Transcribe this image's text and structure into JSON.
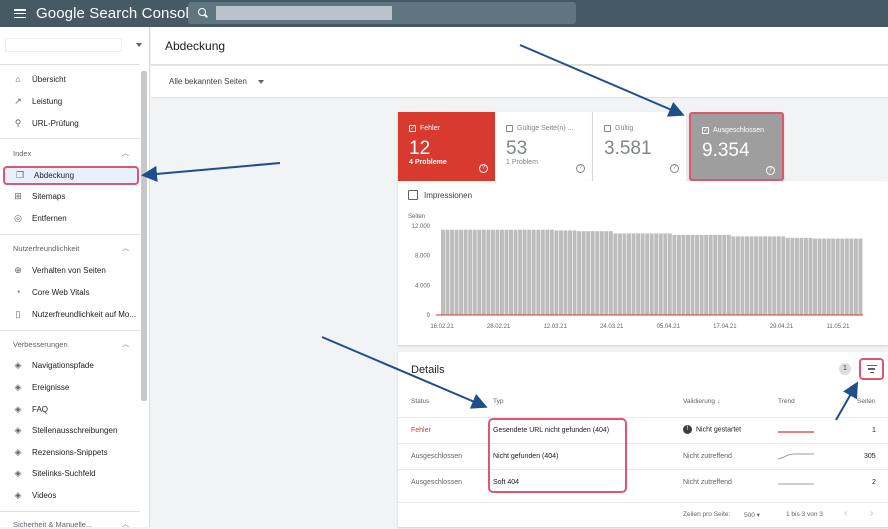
{
  "app": {
    "title": "Google Search Console",
    "search_value": ""
  },
  "header": {
    "title": "Abdeckung"
  },
  "filter": {
    "label": "Alle bekannten Seiten"
  },
  "sidebar": {
    "top_items": [
      {
        "label": "Übersicht",
        "icon": "home-icon"
      },
      {
        "label": "Leistung",
        "icon": "trending-up-icon"
      },
      {
        "label": "URL-Prüfung",
        "icon": "search-icon"
      }
    ],
    "index_section": "Index",
    "index_items": [
      {
        "label": "Abdeckung",
        "icon": "copy-icon"
      },
      {
        "label": "Sitemaps",
        "icon": "sitemap-icon"
      },
      {
        "label": "Entfernen",
        "icon": "eye-off-icon"
      }
    ],
    "usability_section": "Nutzerfreundlichkeit",
    "usability_items": [
      {
        "label": "Verhalten von Seiten",
        "icon": "circle-plus-icon"
      },
      {
        "label": "Core Web Vitals",
        "icon": "speed-icon"
      },
      {
        "label": "Nutzerfreundlichkeit auf Mo...",
        "icon": "phone-icon"
      }
    ],
    "enhancements_section": "Verbesserungen",
    "enhancements_items": [
      {
        "label": "Navigationspfade",
        "icon": "layers-icon"
      },
      {
        "label": "Ereignisse",
        "icon": "layers-icon"
      },
      {
        "label": "FAQ",
        "icon": "layers-icon"
      },
      {
        "label": "Stellenausschreibungen",
        "icon": "layers-icon"
      },
      {
        "label": "Rezensions-Snippets",
        "icon": "layers-icon"
      },
      {
        "label": "Sitelinks-Suchfeld",
        "icon": "layers-icon"
      },
      {
        "label": "Videos",
        "icon": "layers-icon"
      }
    ],
    "security_section": "Sicherheit & Manuelle..."
  },
  "tiles": {
    "error": {
      "label": "Fehler",
      "value": "12",
      "sub": "4 Probleme"
    },
    "warning": {
      "label": "Gültige Seite(n) ...",
      "value": "53",
      "sub": "1 Problem"
    },
    "valid": {
      "label": "Gültig",
      "value": "3.581",
      "sub": ""
    },
    "excluded": {
      "label": "Ausgeschlossen",
      "value": "9.354",
      "sub": ""
    }
  },
  "chart": {
    "impressions_label": "Impressionen",
    "ylabel": "Seiten"
  },
  "chart_data": {
    "type": "bar",
    "ylabel": "Seiten",
    "ylim": [
      0,
      12000
    ],
    "yticks": [
      "12.000",
      "8.000",
      "4.000",
      "0"
    ],
    "xticks": [
      "16.02.21",
      "28.02.21",
      "12.03.21",
      "24.03.21",
      "05.04.21",
      "17.04.21",
      "29.04.21",
      "11.05.21"
    ],
    "values": [
      11500,
      11500,
      11500,
      11500,
      11500,
      11500,
      11500,
      11500,
      11500,
      11500,
      11500,
      11500,
      11500,
      11500,
      11500,
      11500,
      11500,
      11500,
      11500,
      11500,
      11500,
      11500,
      11500,
      11500,
      11500,
      11400,
      11400,
      11400,
      11400,
      11400,
      11300,
      11300,
      11300,
      11300,
      11300,
      11300,
      11300,
      11300,
      11000,
      11000,
      11000,
      11000,
      11000,
      11000,
      11000,
      11000,
      11000,
      11000,
      11000,
      11000,
      11000,
      10800,
      10800,
      10800,
      10800,
      10800,
      10800,
      10800,
      10800,
      10800,
      10800,
      10800,
      10800,
      10800,
      10600,
      10600,
      10600,
      10600,
      10600,
      10600,
      10600,
      10600,
      10600,
      10600,
      10600,
      10600,
      10400,
      10400,
      10400,
      10400,
      10400,
      10400,
      10300,
      10300,
      10300,
      10300,
      10300,
      10300,
      10300,
      10300,
      10300,
      10300,
      10300
    ],
    "series_color": "#bdbdbd",
    "line_color": "#d93a30"
  },
  "details": {
    "title": "Details",
    "badge": "1",
    "headers": {
      "status": "Status",
      "type": "Typ",
      "validation": "Validierung",
      "trend": "Trend",
      "pages": "Seiten"
    },
    "rows": [
      {
        "status": "Fehler",
        "type": "Gesendete URL nicht gefunden (404)",
        "validation": "Nicht gestartet",
        "validation_icon": "!",
        "pages": "1"
      },
      {
        "status": "Ausgeschlossen",
        "type": "Nicht gefunden (404)",
        "validation": "Nicht zutreffend",
        "pages": "305"
      },
      {
        "status": "Ausgeschlossen",
        "type": "Soft 404",
        "validation": "Nicht zutreffend",
        "pages": "2"
      }
    ],
    "footer": {
      "rows_per_page_label": "Zeilen pro Seite:",
      "rows_per_page": "500",
      "range": "1 bis 3 von 3"
    }
  }
}
